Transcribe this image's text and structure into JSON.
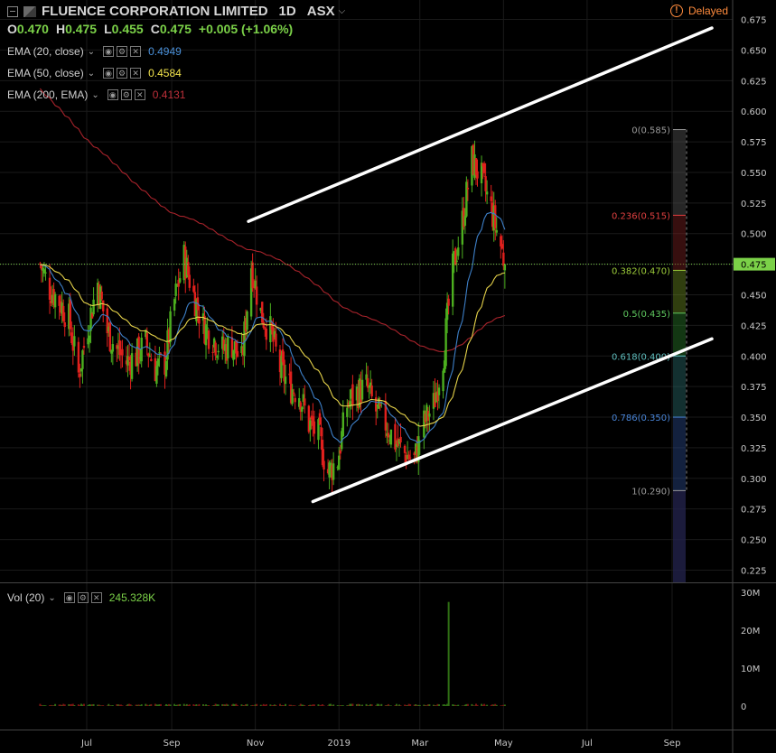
{
  "header": {
    "symbol": "FLUENCE CORPORATION LIMITED",
    "interval": "1D",
    "exchange": "ASX",
    "delayed_label": "Delayed",
    "ohlc": {
      "o_label": "O",
      "o": "0.470",
      "h_label": "H",
      "h": "0.475",
      "l_label": "L",
      "l": "0.455",
      "c_label": "C",
      "c": "0.475",
      "change": "+0.005 (+1.06%)"
    }
  },
  "indicators": [
    {
      "label": "EMA (20, close)",
      "value": "0.4949",
      "color": "#4a90d9"
    },
    {
      "label": "EMA (50, close)",
      "value": "0.4584",
      "color": "#f2e34c"
    },
    {
      "label": "EMA (200, EMA)",
      "value": "0.4131",
      "color": "#b0202a"
    }
  ],
  "volume_panel": {
    "label": "Vol (20)",
    "value": "245.328K"
  },
  "colors": {
    "up": "#4caf1f",
    "down": "#e0201d",
    "ema20": "#3d7fc7",
    "ema50": "#e6d34a",
    "ema200": "#a8232b",
    "last_price": "#7bd148",
    "background": "#000000",
    "grid": "#1a1a1a",
    "delayed": "#ff8b3d"
  },
  "chart_data": [
    {
      "type": "candlestick",
      "title": "FLUENCE CORPORATION LIMITED",
      "x_tick_labels": [
        "Jul",
        "Sep",
        "Nov",
        "2019",
        "Mar",
        "May",
        "Jul",
        "Sep"
      ],
      "y_tick_labels": [
        "0.675",
        "0.650",
        "0.625",
        "0.600",
        "0.575",
        "0.550",
        "0.525",
        "0.500",
        "0.475",
        "0.450",
        "0.425",
        "0.400",
        "0.375",
        "0.350",
        "0.325",
        "0.300",
        "0.275",
        "0.250",
        "0.225"
      ],
      "ylim": [
        0.215,
        0.685
      ],
      "last_price": 0.475,
      "grid": true,
      "price_series": [
        [
          "2018-05-28",
          0.475
        ],
        [
          "2018-06-04",
          0.455
        ],
        [
          "2018-06-11",
          0.445
        ],
        [
          "2018-06-18",
          0.43
        ],
        [
          "2018-06-25",
          0.385
        ],
        [
          "2018-07-02",
          0.425
        ],
        [
          "2018-07-09",
          0.46
        ],
        [
          "2018-07-16",
          0.42
        ],
        [
          "2018-07-23",
          0.405
        ],
        [
          "2018-07-30",
          0.395
        ],
        [
          "2018-08-06",
          0.4
        ],
        [
          "2018-08-13",
          0.41
        ],
        [
          "2018-08-20",
          0.39
        ],
        [
          "2018-08-27",
          0.395
        ],
        [
          "2018-09-03",
          0.445
        ],
        [
          "2018-09-10",
          0.48
        ],
        [
          "2018-09-17",
          0.45
        ],
        [
          "2018-09-24",
          0.425
        ],
        [
          "2018-10-01",
          0.415
        ],
        [
          "2018-10-08",
          0.405
        ],
        [
          "2018-10-15",
          0.41
        ],
        [
          "2018-10-22",
          0.395
        ],
        [
          "2018-10-29",
          0.475
        ],
        [
          "2018-11-05",
          0.435
        ],
        [
          "2018-11-12",
          0.42
        ],
        [
          "2018-11-19",
          0.39
        ],
        [
          "2018-11-26",
          0.375
        ],
        [
          "2018-12-03",
          0.37
        ],
        [
          "2018-12-10",
          0.345
        ],
        [
          "2018-12-17",
          0.335
        ],
        [
          "2018-12-24",
          0.305
        ],
        [
          "2018-12-31",
          0.315
        ],
        [
          "2019-01-07",
          0.36
        ],
        [
          "2019-01-14",
          0.37
        ],
        [
          "2019-01-21",
          0.375
        ],
        [
          "2019-01-28",
          0.355
        ],
        [
          "2019-02-04",
          0.345
        ],
        [
          "2019-02-11",
          0.33
        ],
        [
          "2019-02-18",
          0.32
        ],
        [
          "2019-02-25",
          0.315
        ],
        [
          "2019-03-04",
          0.345
        ],
        [
          "2019-03-11",
          0.36
        ],
        [
          "2019-03-18",
          0.4
        ],
        [
          "2019-03-25",
          0.47
        ],
        [
          "2019-04-01",
          0.51
        ],
        [
          "2019-04-08",
          0.56
        ],
        [
          "2019-04-15",
          0.545
        ],
        [
          "2019-04-22",
          0.52
        ],
        [
          "2019-04-29",
          0.49
        ],
        [
          "2019-05-02",
          0.475
        ]
      ],
      "ema": [
        {
          "name": "EMA (20, close)",
          "value": 0.4949
        },
        {
          "name": "EMA (50, close)",
          "value": 0.4584
        },
        {
          "name": "EMA (200, EMA)",
          "value": 0.4131
        }
      ],
      "trend_lines": [
        {
          "from": [
            "2018-10-27",
            0.51
          ],
          "to": [
            "2019-09-30",
            0.668
          ]
        },
        {
          "from": [
            "2018-12-13",
            0.281
          ],
          "to": [
            "2019-09-30",
            0.414
          ]
        }
      ],
      "fibonacci": [
        {
          "label": "0(0.585)",
          "value": 0.585
        },
        {
          "label": "0.236(0.515)",
          "value": 0.515
        },
        {
          "label": "0.382(0.470)",
          "value": 0.47
        },
        {
          "label": "0.5(0.435)",
          "value": 0.435
        },
        {
          "label": "0.618(0.400)",
          "value": 0.4
        },
        {
          "label": "0.786(0.350)",
          "value": 0.35
        },
        {
          "label": "1(0.290)",
          "value": 0.29
        }
      ]
    },
    {
      "type": "bar",
      "title": "Vol (20)",
      "y_tick_labels": [
        "30M",
        "20M",
        "10M",
        "0"
      ],
      "ylim": [
        0,
        31
      ],
      "spike": {
        "date": "2019-03-22",
        "value": 27.5
      },
      "baseline_level": 0.3
    }
  ]
}
